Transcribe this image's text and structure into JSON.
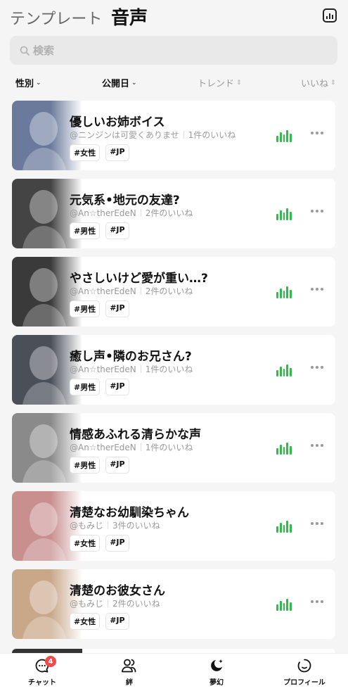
{
  "header": {
    "tab_template": "テンプレート",
    "tab_voice": "音声",
    "chart_icon": "bar-chart-icon"
  },
  "search": {
    "placeholder": "検索",
    "icon": "search-icon"
  },
  "filters": {
    "gender": "性別",
    "date": "公開日",
    "trend": "トレンド",
    "likes": "いいね"
  },
  "items": [
    {
      "title": "優しいお姉ボイス",
      "author": "@ニンジンは可愛くありませ",
      "likes": "1件のいいね",
      "tags": [
        "#女性",
        "#JP"
      ],
      "thumb_color": "#6b7a9c"
    },
    {
      "title": "元気系•地元の友達?",
      "author": "@An☆therEdeN",
      "likes": "2件のいいね",
      "tags": [
        "#男性",
        "#JP"
      ],
      "thumb_color": "#444444"
    },
    {
      "title": "やさしいけど愛が重い…?",
      "author": "@An☆therEdeN",
      "likes": "2件のいいね",
      "tags": [
        "#男性",
        "#JP"
      ],
      "thumb_color": "#3a3a3a"
    },
    {
      "title": "癒し声•隣のお兄さん?",
      "author": "@An☆therEdeN",
      "likes": "1件のいいね",
      "tags": [
        "#男性",
        "#JP"
      ],
      "thumb_color": "#4a4f58"
    },
    {
      "title": "情感あふれる清らかな声",
      "author": "@An☆therEdeN",
      "likes": "1件のいいね",
      "tags": [
        "#男性",
        "#JP"
      ],
      "thumb_color": "#8a8a8a"
    },
    {
      "title": "清楚なお幼馴染ちゃん",
      "author": "@もみじ",
      "likes": "3件のいいね",
      "tags": [
        "#女性",
        "#JP"
      ],
      "thumb_color": "#c98f8f"
    },
    {
      "title": "清楚のお彼女さん",
      "author": "@もみじ",
      "likes": "2件のいいね",
      "tags": [
        "#女性",
        "#JP"
      ],
      "thumb_color": "#c9a88a"
    }
  ],
  "nav": {
    "chat": "チャット",
    "chat_badge": "4",
    "bond": "絆",
    "dream": "夢幻",
    "profile": "プロフィール"
  },
  "colors": {
    "accent_green": "#2fbd4a",
    "badge_red": "#f04a4a"
  }
}
